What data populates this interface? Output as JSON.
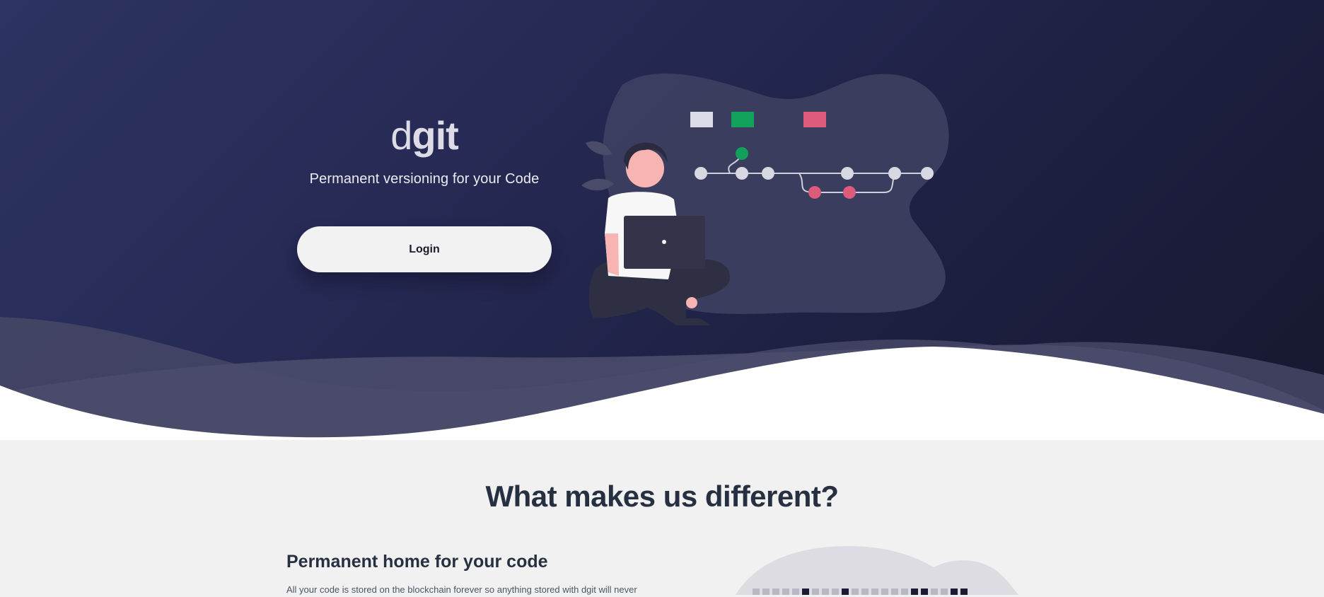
{
  "hero": {
    "brand_prefix": "d",
    "brand_suffix": "git",
    "tagline": "Permanent versioning for your  Code",
    "login_label": "Login"
  },
  "features": {
    "title": "What makes us different?",
    "items": [
      {
        "heading": "Permanent home for your code",
        "text": "All your code is stored on the blockchain forever so anything stored with dgit will never"
      }
    ]
  },
  "colors": {
    "hero_gradient_start": "#2d3362",
    "hero_gradient_end": "#17182f",
    "accent_green": "#12a15b",
    "accent_pink": "#dd5b7b",
    "text_dark": "#263040"
  }
}
